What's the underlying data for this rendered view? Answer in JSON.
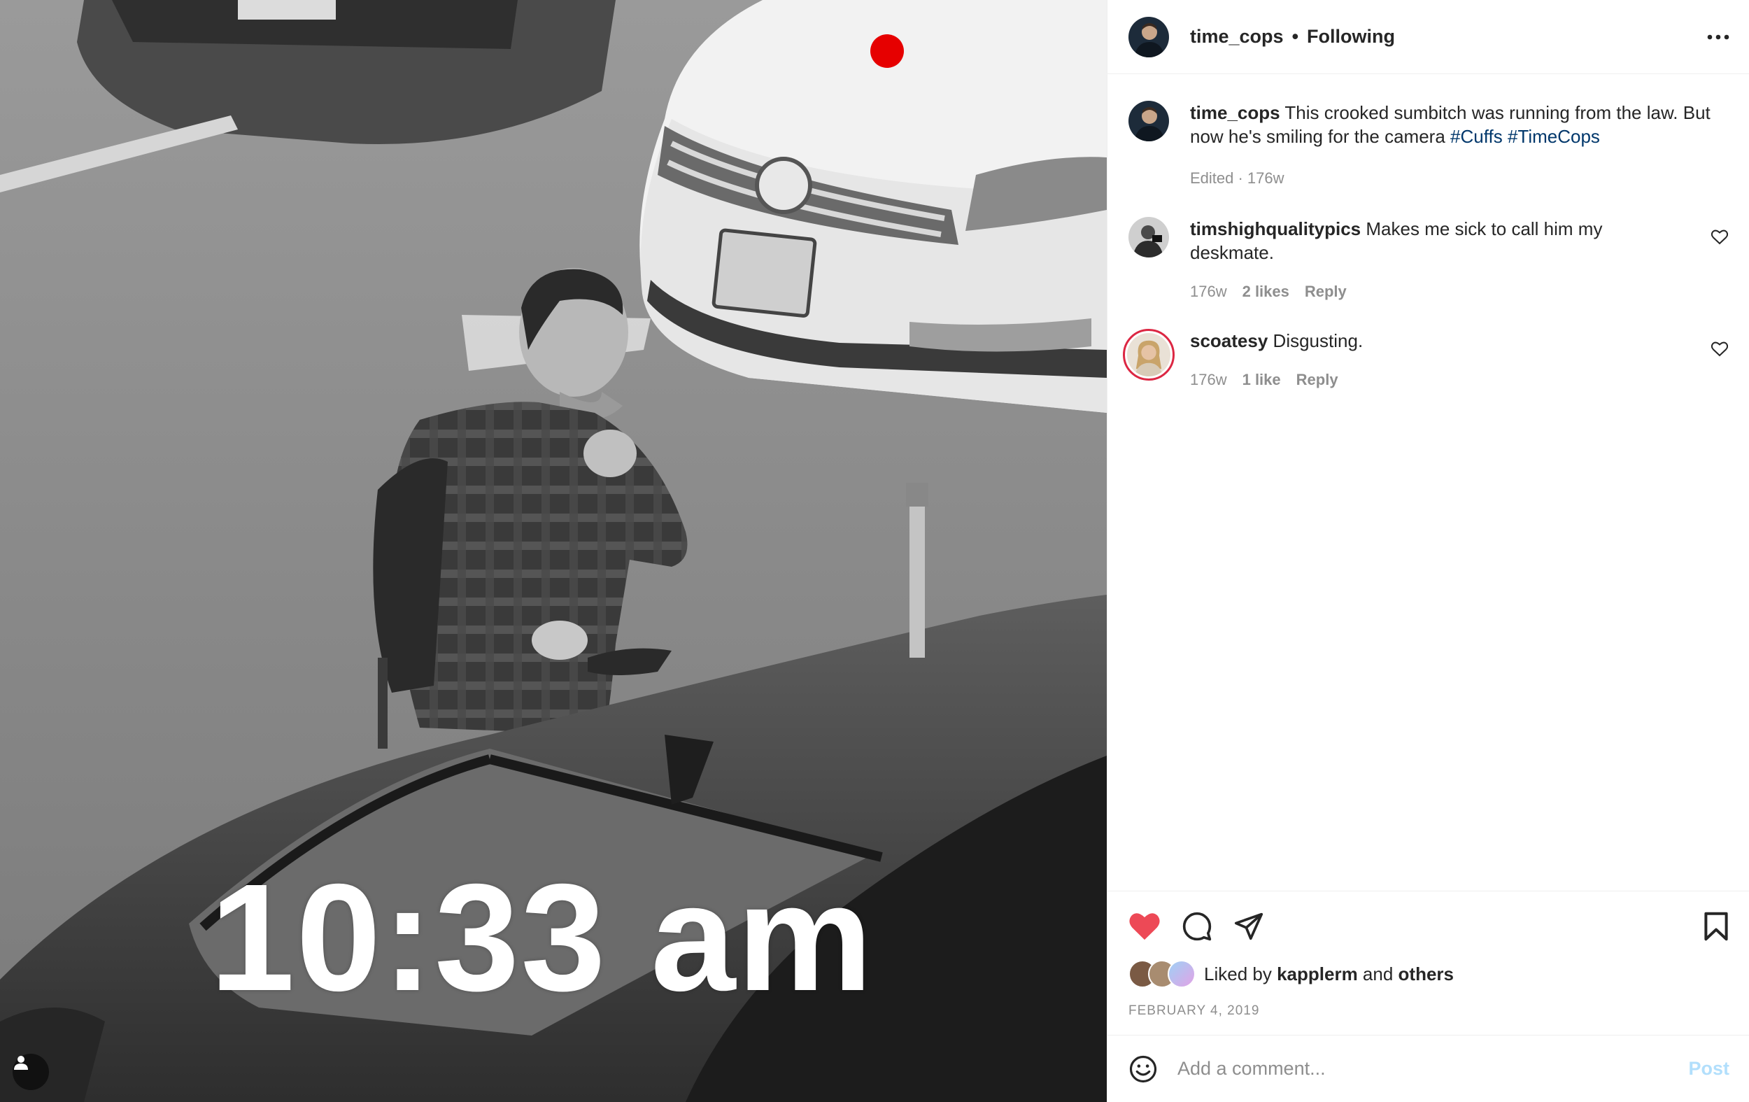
{
  "photo": {
    "timestamp": "10:33 am",
    "tag_icon": "user-tag-icon"
  },
  "header": {
    "username": "time_cops",
    "separator": "•",
    "follow_status": "Following",
    "more_icon": "more-options-icon"
  },
  "caption": {
    "username": "time_cops",
    "text": "This crooked sumbitch was running from the law. But now he's smiling for the camera",
    "hashtags": [
      "#Cuffs",
      "#TimeCops"
    ],
    "edited": "Edited · 176w"
  },
  "comments": [
    {
      "username": "timshighqualitypics",
      "text": "Makes me sick to call him my deskmate.",
      "age": "176w",
      "likes": "2 likes",
      "reply": "Reply"
    },
    {
      "username": "scoatesy",
      "text": "Disgusting.",
      "age": "176w",
      "likes": "1 like",
      "reply": "Reply"
    }
  ],
  "actions": {
    "like_icon": "heart-icon",
    "comment_icon": "comment-icon",
    "share_icon": "share-icon",
    "save_icon": "bookmark-icon",
    "liked_state": true,
    "like_color": "#ed4956"
  },
  "likes": {
    "prefix": "Liked by",
    "user": "kapplerm",
    "and": "and",
    "others": "others"
  },
  "date": "FEBRUARY 4, 2019",
  "add_comment": {
    "placeholder": "Add a comment...",
    "post_label": "Post",
    "emoji_icon": "emoji-icon"
  }
}
